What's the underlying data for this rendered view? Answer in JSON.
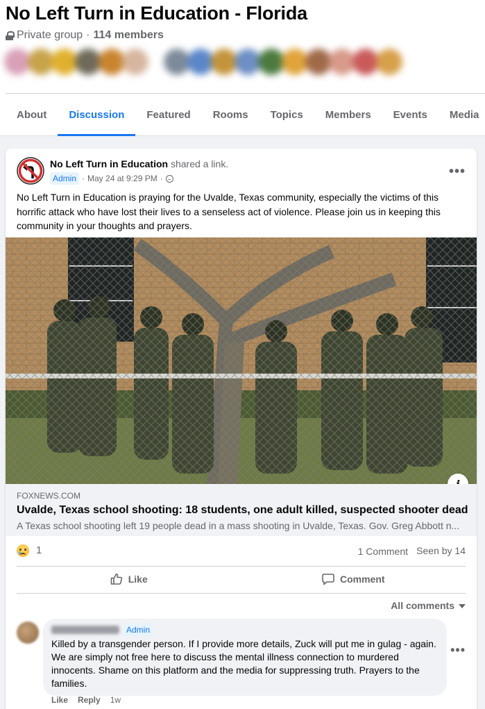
{
  "group": {
    "title": "No Left Turn in Education - Florida",
    "privacy": "Private group",
    "separator": "·",
    "member_count": "114 members"
  },
  "tabs": [
    {
      "label": "About",
      "active": false
    },
    {
      "label": "Discussion",
      "active": true
    },
    {
      "label": "Featured",
      "active": false
    },
    {
      "label": "Rooms",
      "active": false
    },
    {
      "label": "Topics",
      "active": false
    },
    {
      "label": "Members",
      "active": false
    },
    {
      "label": "Events",
      "active": false
    },
    {
      "label": "Media",
      "active": false
    }
  ],
  "post": {
    "author": "No Left Turn in Education",
    "action": "shared a link.",
    "role": "Admin",
    "timestamp": "May 24 at 9:29 PM",
    "dot": "·",
    "text": "No Left Turn in Education is praying for the Uvalde, Texas community, especially the victims of this horrific attack who have lost their lives to a senseless act of violence. Please join us in keeping this community in your thoughts and prayers.",
    "more": "•••",
    "link": {
      "domain": "FOXNEWS.COM",
      "title": "Uvalde, Texas school shooting: 18 students, one adult killed, suspected shooter dead",
      "description": "A Texas school shooting left 19 people dead in a mass shooting in Uvalde, Texas. Gov. Greg Abbott n...",
      "info": "i"
    },
    "reactions": {
      "count": "1"
    },
    "comments_count": "1 Comment",
    "seen_by": "Seen by 14",
    "actions": {
      "like": "Like",
      "comment": "Comment"
    },
    "all_comments": "All comments"
  },
  "comment": {
    "role": "Admin",
    "text": "Killed by a transgender person. If I provide more details, Zuck will put me in gulag - again. We are simply not free here to discuss the mental illness connection to murdered innocents. Shame on this platform and the media for suppressing truth. Prayers to the families.",
    "like": "Like",
    "reply": "Reply",
    "age": "1w",
    "more": "•••"
  },
  "colors": {
    "accent": "#1877f2",
    "secondary_text": "#65676b",
    "background": "#f0f2f5",
    "no_turn_sign_red": "#d32f2f"
  }
}
